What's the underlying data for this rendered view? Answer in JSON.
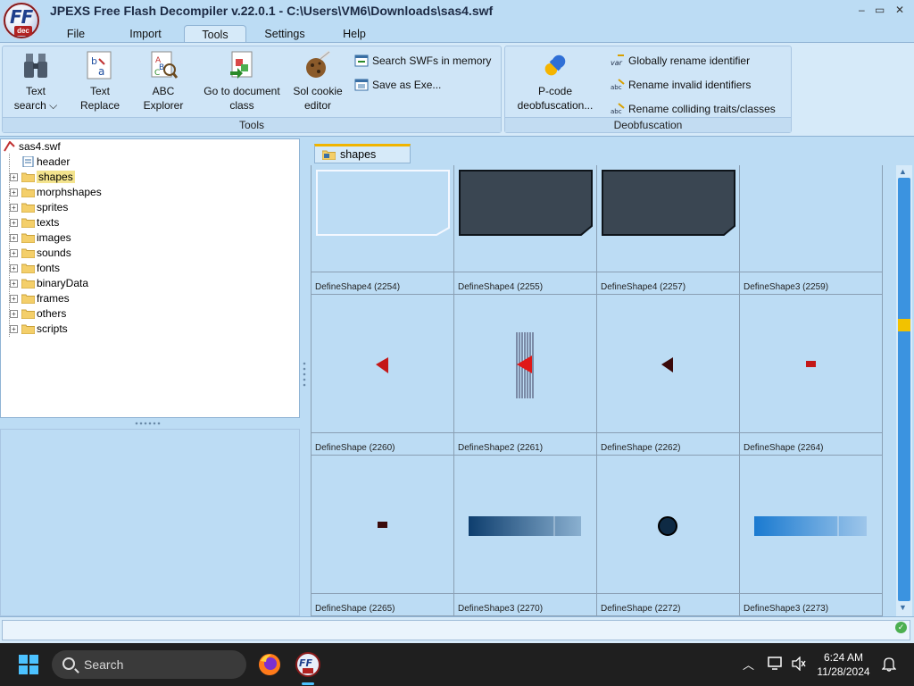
{
  "window": {
    "title": "JPEXS Free Flash Decompiler v.22.0.1 - C:\\Users\\VM6\\Downloads\\sas4.swf",
    "logo_text": "FF",
    "logo_sub": "dec",
    "controls": [
      "–",
      "▭",
      "✕"
    ]
  },
  "menu": {
    "tabs": [
      {
        "label": "File",
        "active": false
      },
      {
        "label": "Import",
        "active": false
      },
      {
        "label": "Tools",
        "active": true
      },
      {
        "label": "Settings",
        "active": false
      },
      {
        "label": "Help",
        "active": false
      }
    ]
  },
  "ribbon": {
    "tools_group": {
      "label": "Tools",
      "text_search": "Text",
      "text_search_sub": "search",
      "text_replace": "Text",
      "text_replace_sub": "Replace",
      "abc_explorer": "ABC",
      "abc_explorer_sub": "Explorer",
      "go_to_document": "Go to document",
      "go_to_document_sub": "class",
      "sol_cookie": "Sol cookie",
      "sol_cookie_sub": "editor",
      "search_swfs": "Search SWFs in memory",
      "save_as_exe": "Save as Exe..."
    },
    "deobf_group": {
      "label": "Deobfuscation",
      "pcode": "P-code",
      "pcode_sub": "deobfuscation...",
      "globally_rename": "Globally rename identifier",
      "rename_invalid": "Rename invalid identifiers",
      "rename_colliding": "Rename colliding traits/classes"
    }
  },
  "tree": {
    "root": "sas4.swf",
    "items": [
      {
        "label": "header",
        "icon": "header-icon",
        "expandable": false,
        "selected": false
      },
      {
        "label": "shapes",
        "icon": "folder-shapes-icon",
        "expandable": true,
        "selected": true
      },
      {
        "label": "morphshapes",
        "icon": "folder-morphshapes-icon",
        "expandable": true,
        "selected": false
      },
      {
        "label": "sprites",
        "icon": "folder-sprites-icon",
        "expandable": true,
        "selected": false
      },
      {
        "label": "texts",
        "icon": "folder-texts-icon",
        "expandable": true,
        "selected": false
      },
      {
        "label": "images",
        "icon": "folder-images-icon",
        "expandable": true,
        "selected": false
      },
      {
        "label": "sounds",
        "icon": "folder-sounds-icon",
        "expandable": true,
        "selected": false
      },
      {
        "label": "fonts",
        "icon": "folder-fonts-icon",
        "expandable": true,
        "selected": false
      },
      {
        "label": "binaryData",
        "icon": "folder-binarydata-icon",
        "expandable": true,
        "selected": false
      },
      {
        "label": "frames",
        "icon": "folder-frames-icon",
        "expandable": true,
        "selected": false
      },
      {
        "label": "others",
        "icon": "folder-others-icon",
        "expandable": true,
        "selected": false
      },
      {
        "label": "scripts",
        "icon": "folder-scripts-icon",
        "expandable": true,
        "selected": false
      }
    ]
  },
  "content": {
    "tab_label": "shapes",
    "cells": [
      {
        "caption": "DefineShape4 (2254)",
        "preview": "outline-panel"
      },
      {
        "caption": "DefineShape4 (2255)",
        "preview": "dark-panel"
      },
      {
        "caption": "DefineShape4 (2257)",
        "preview": "dark-panel"
      },
      {
        "caption": "DefineShape3 (2259)",
        "preview": "empty"
      },
      {
        "caption": "DefineShape (2260)",
        "preview": "red-triangle"
      },
      {
        "caption": "DefineShape2 (2261)",
        "preview": "striped-triangle"
      },
      {
        "caption": "DefineShape (2262)",
        "preview": "dark-triangle"
      },
      {
        "caption": "DefineShape (2264)",
        "preview": "red-rect"
      },
      {
        "caption": "DefineShape (2265)",
        "preview": "dark-rect"
      },
      {
        "caption": "DefineShape3 (2270)",
        "preview": "dark-gradient-bar"
      },
      {
        "caption": "DefineShape (2272)",
        "preview": "dark-circle"
      },
      {
        "caption": "DefineShape3 (2273)",
        "preview": "blue-gradient-bar"
      }
    ]
  },
  "taskbar": {
    "search_placeholder": "Search",
    "time": "6:24 AM",
    "date": "11/28/2024"
  }
}
